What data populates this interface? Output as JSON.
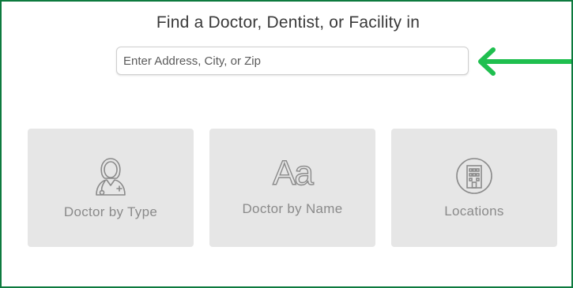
{
  "heading": "Find a Doctor, Dentist, or Facility in",
  "search": {
    "placeholder": "Enter Address, City, or Zip"
  },
  "annotation": {
    "arrow_color": "#1fbf4f",
    "icon": "left-arrow-icon"
  },
  "tiles": [
    {
      "label": "Doctor by Type",
      "icon": "doctor-icon"
    },
    {
      "label": "Doctor by Name",
      "icon": "aa-icon",
      "icon_text": "Aa"
    },
    {
      "label": "Locations",
      "icon": "building-icon"
    }
  ],
  "colors": {
    "frame_border": "#0d7a3e",
    "tile_bg": "#e6e6e6",
    "tile_text": "#8a8a8a",
    "heading_text": "#3a3a3a"
  }
}
